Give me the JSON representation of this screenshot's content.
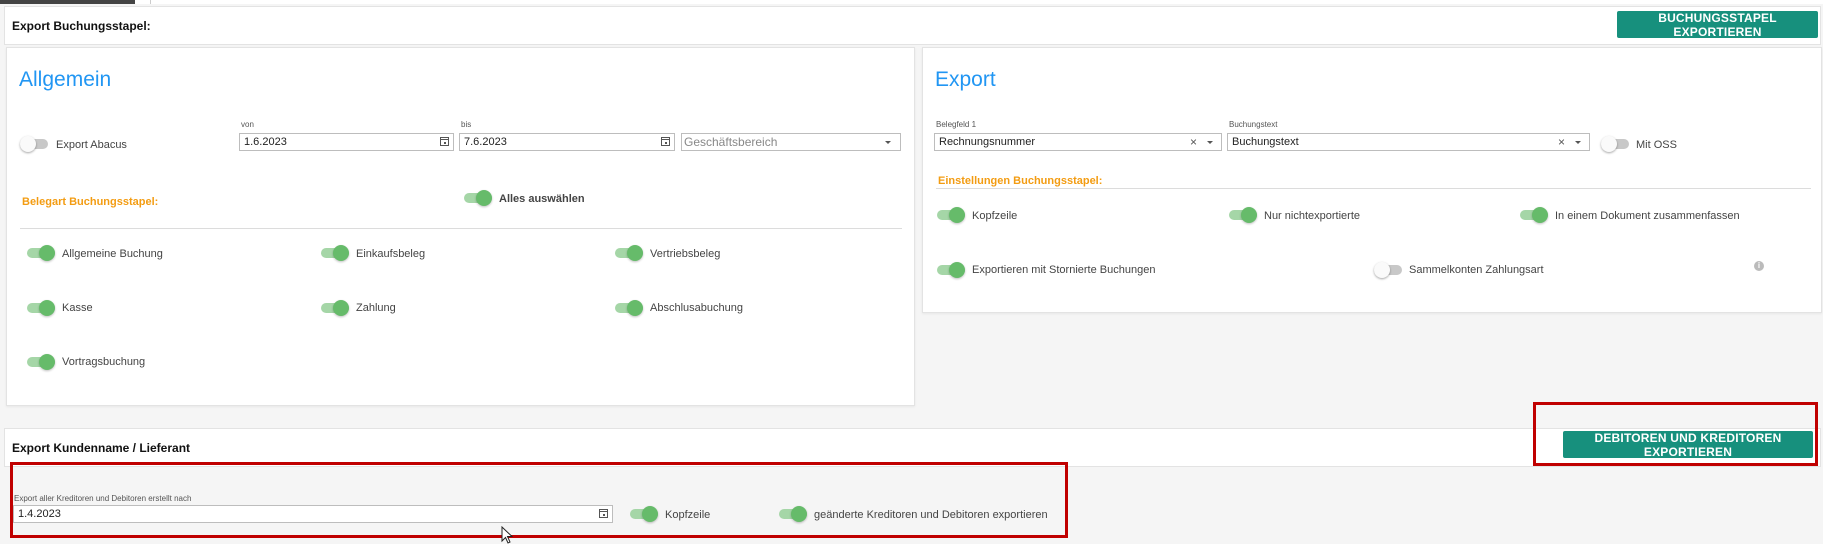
{
  "top_bar": {
    "title": "Export Buchungsstapel:",
    "export_button": "BUCHUNGSSTAPEL EXPORTIEREN"
  },
  "allgemein": {
    "title": "Allgemein",
    "export_abacus": {
      "label": "Export Abacus",
      "on": false
    },
    "von": {
      "label": "von",
      "value": "1.6.2023"
    },
    "bis": {
      "label": "bis",
      "value": "7.6.2023"
    },
    "geschaeftsbereich": {
      "placeholder": "Geschäftsbereich"
    },
    "belegart_title": "Belegart Buchungsstapel:",
    "alles_auswaehlen": {
      "label": "Alles auswählen",
      "on": true
    },
    "belegarten": [
      {
        "label": "Allgemeine Buchung",
        "on": true
      },
      {
        "label": "Einkaufsbeleg",
        "on": true
      },
      {
        "label": "Vertriebsbeleg",
        "on": true
      },
      {
        "label": "Kasse",
        "on": true
      },
      {
        "label": "Zahlung",
        "on": true
      },
      {
        "label": "Abschlusabuchung",
        "on": true
      },
      {
        "label": "Vortragsbuchung",
        "on": true
      }
    ]
  },
  "export": {
    "title": "Export",
    "belegfeld": {
      "label": "Belegfeld 1",
      "value": "Rechnungsnummer"
    },
    "buchungstext": {
      "label": "Buchungstext",
      "value": "Buchungstext"
    },
    "mit_oss": {
      "label": "Mit OSS",
      "on": false
    },
    "einstellungen_title": "Einstellungen Buchungsstapel:",
    "options": [
      {
        "label": "Kopfzeile",
        "on": true
      },
      {
        "label": "Nur nichtexportierte",
        "on": true
      },
      {
        "label": "In einem Dokument zusammenfassen",
        "on": true
      },
      {
        "label": "Exportieren mit Stornierte Buchungen",
        "on": true
      },
      {
        "label": "Sammelkonten Zahlungsart",
        "on": false
      }
    ]
  },
  "kunden": {
    "title": "Export Kundenname / Lieferant",
    "export_button": "DEBITOREN UND KREDITOREN EXPORTIEREN",
    "date": {
      "label": "Export aller Kreditoren und Debitoren erstellt nach",
      "value": "1.4.2023"
    },
    "kopfzeile": {
      "label": "Kopfzeile",
      "on": true
    },
    "geaenderte": {
      "label": "geänderte Kreditoren und Debitoren exportieren",
      "on": true
    }
  },
  "colors": {
    "accent_blue": "#2196f3",
    "teal_button": "#17907d",
    "orange_section": "#f39c12",
    "toggle_green": "#66bb6a",
    "highlight_red": "#c00000"
  }
}
